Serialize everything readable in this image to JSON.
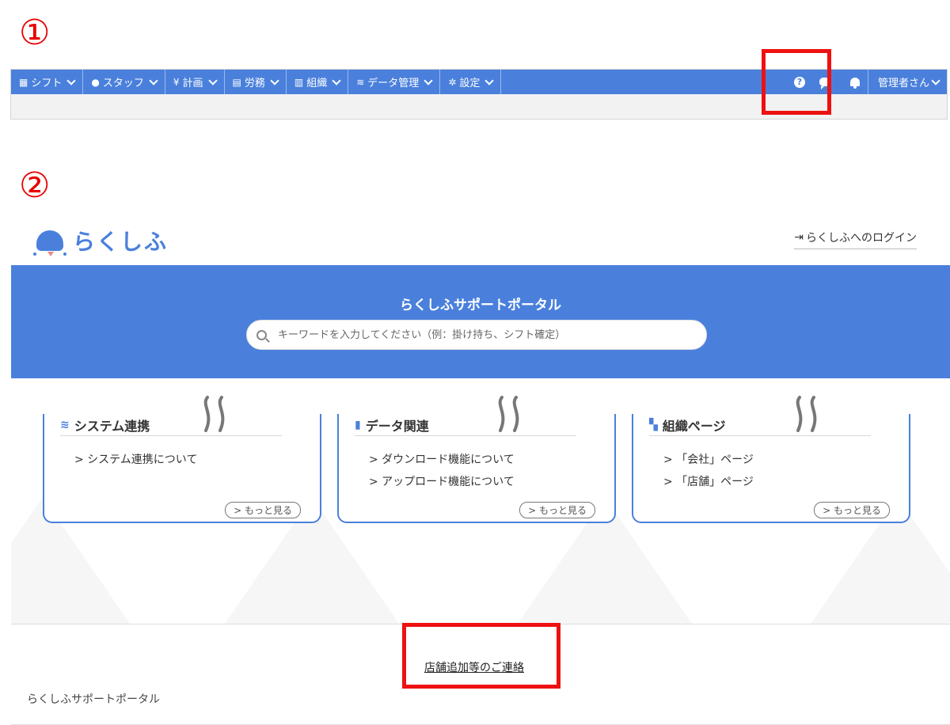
{
  "markers": {
    "one": "①",
    "two": "②"
  },
  "navbar": {
    "items": [
      {
        "icon": "calendar-icon",
        "label": "シフト"
      },
      {
        "icon": "person-icon",
        "label": "スタッフ"
      },
      {
        "icon": "yen-icon",
        "label": "計画"
      },
      {
        "icon": "document-icon",
        "label": "労務"
      },
      {
        "icon": "building-icon",
        "label": "組織"
      },
      {
        "icon": "database-icon",
        "label": "データ管理"
      },
      {
        "icon": "gear-icon",
        "label": "設定"
      }
    ],
    "user_label": "管理者さん"
  },
  "portal": {
    "logo_text": "らくしふ",
    "login_link": "らくしふへのログイン",
    "hero_title": "らくしふサポートポータル",
    "search_placeholder": "キーワードを入力してください（例：掛け持ち、シフト確定）",
    "cards": [
      {
        "title": "システム連携",
        "icon": "database-icon",
        "items": [
          "> システム連携について"
        ],
        "more": "> もっと見る"
      },
      {
        "title": "データ関連",
        "icon": "bar-chart-icon",
        "items": [
          "> ダウンロード機能について",
          "> アップロード機能について"
        ],
        "more": "> もっと見る"
      },
      {
        "title": "組織ページ",
        "icon": "bookmark-icon",
        "items": [
          "> 「会社」ページ",
          "> 「店舗」ページ"
        ],
        "more": "> もっと見る"
      }
    ],
    "footer_link": "店舗追加等のご連絡",
    "footer_brand": "らくしふサポートポータル"
  },
  "colors": {
    "brand_blue": "#4a80dc",
    "highlight_red": "#ee1111",
    "marker_red": "#e60000"
  }
}
